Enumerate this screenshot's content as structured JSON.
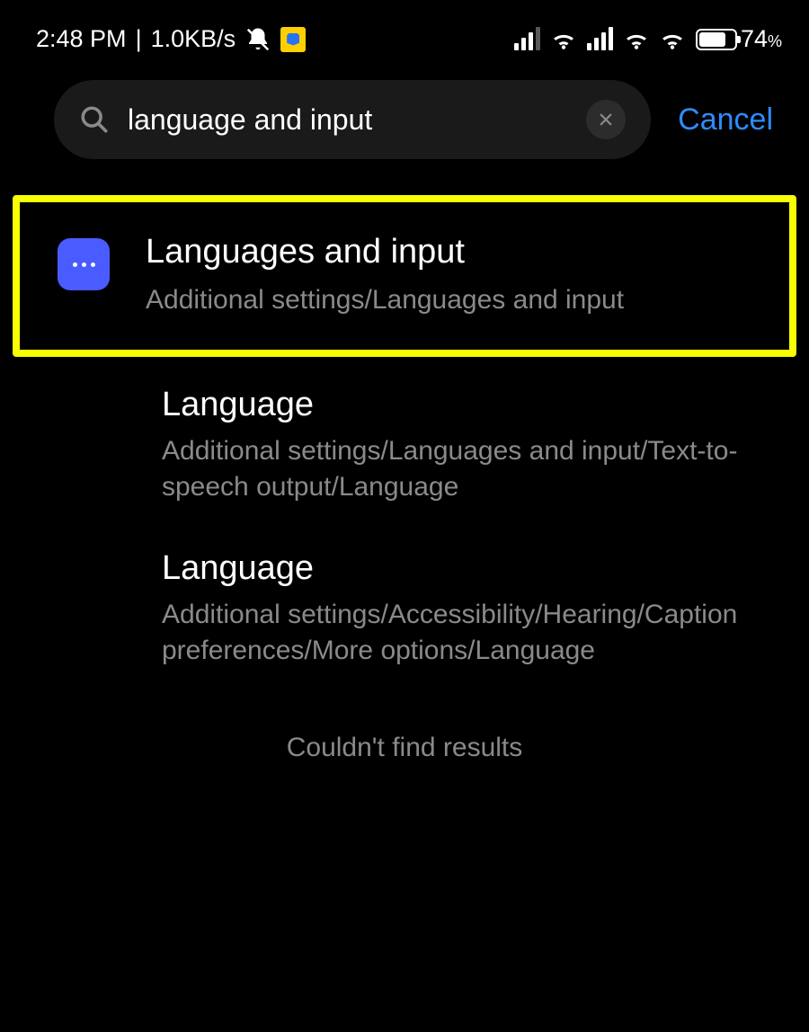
{
  "status_bar": {
    "time": "2:48 PM",
    "separator": "|",
    "data_rate": "1.0KB/s",
    "battery_pct": "74",
    "battery_pct_symbol": "%"
  },
  "search": {
    "value": "language and input",
    "cancel_label": "Cancel"
  },
  "results": [
    {
      "title": "Languages and input",
      "path": "Additional settings/Languages and input"
    },
    {
      "title": "Language",
      "path": "Additional settings/Languages and input/Text-to-speech output/Language"
    },
    {
      "title": "Language",
      "path": "Additional settings/Accessibility/Hearing/Caption preferences/More options/Language"
    }
  ],
  "footer_message": "Couldn't find results"
}
